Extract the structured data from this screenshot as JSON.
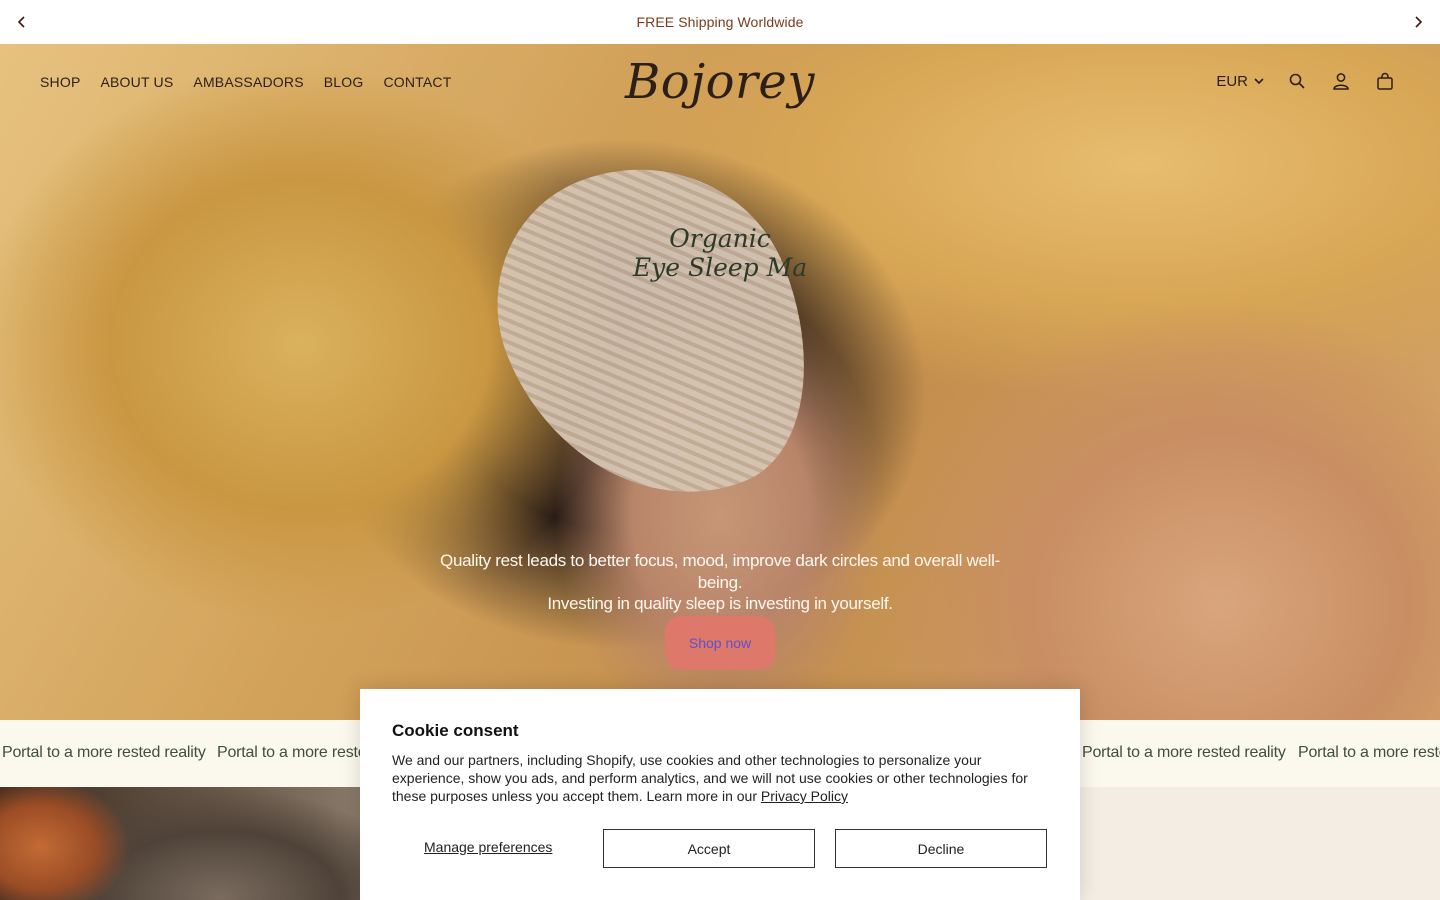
{
  "announcement": {
    "text": "FREE Shipping Worldwide",
    "prev_icon": "chevron-left-icon",
    "next_icon": "chevron-right-icon"
  },
  "header": {
    "logo": "Bojorey",
    "nav": [
      "SHOP",
      "ABOUT US",
      "AMBASSADORS",
      "BLOG",
      "CONTACT"
    ],
    "currency": "EUR",
    "icons": [
      "search-icon",
      "account-icon",
      "cart-icon"
    ]
  },
  "hero": {
    "title_line1": "Organic",
    "title_line2": "Eye Sleep Ma",
    "subtitle_line1": "Quality rest leads to better focus, mood, improve dark circles and overall well-being.",
    "subtitle_line2": "Investing in quality sleep is investing in yourself.",
    "cta": "Shop now"
  },
  "marquee": {
    "items": [
      "Portal to a more rested reality",
      "Portal to a more reste",
      "Portal to a more rested reality",
      "Portal to a more reste"
    ]
  },
  "cookie": {
    "title": "Cookie consent",
    "body": "We and our partners, including Shopify, use cookies and other technologies to personalize your experience, show you ads, and perform analytics, and we will not use cookies or other technologies for these purposes unless you accept them. Learn more in our ",
    "privacy_link": "Privacy Policy",
    "manage": "Manage preferences",
    "accept": "Accept",
    "decline": "Decline"
  },
  "colors": {
    "announcement_text": "#7b3b1a",
    "cta_bg": "#dd786b",
    "cta_text": "#5d52c9",
    "marquee_text": "#3f4f3a",
    "marquee_bg": "#fbf8ee"
  }
}
